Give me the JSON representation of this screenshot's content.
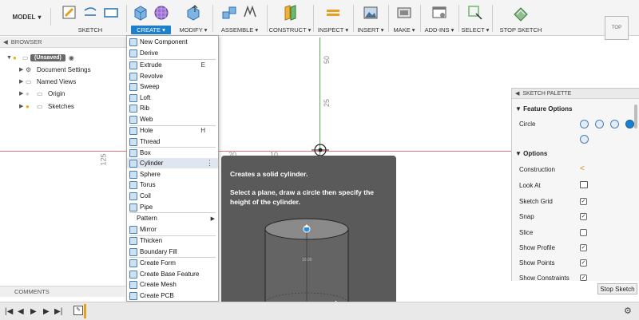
{
  "toolbar": {
    "model_label": "MODEL",
    "groups": [
      "SKETCH",
      "CREATE",
      "MODIFY",
      "ASSEMBLE",
      "CONSTRUCT",
      "INSPECT",
      "INSERT",
      "MAKE",
      "ADD-INS",
      "SELECT",
      "STOP SKETCH"
    ],
    "accent_color": "#1e7fcb"
  },
  "viewcube": {
    "label": "TOP"
  },
  "browser": {
    "title": "BROWSER",
    "items": [
      {
        "label": "(Unsaved)",
        "icon": "lightbulb-icon"
      },
      {
        "label": "Document Settings",
        "icon": "gear-icon"
      },
      {
        "label": "Named Views",
        "icon": "folder-icon"
      },
      {
        "label": "Origin",
        "icon": "folder-icon"
      },
      {
        "label": "Sketches",
        "icon": "folder-icon"
      }
    ]
  },
  "canvas": {
    "ruler_labels": [
      "50",
      "25",
      "125",
      "20",
      "10"
    ]
  },
  "create_menu": {
    "items": [
      {
        "label": "New Component",
        "shortcut": ""
      },
      {
        "label": "Derive",
        "shortcut": ""
      },
      {
        "label": "Extrude",
        "shortcut": "E"
      },
      {
        "label": "Revolve",
        "shortcut": ""
      },
      {
        "label": "Sweep",
        "shortcut": ""
      },
      {
        "label": "Loft",
        "shortcut": ""
      },
      {
        "label": "Rib",
        "shortcut": ""
      },
      {
        "label": "Web",
        "shortcut": ""
      },
      {
        "label": "Hole",
        "shortcut": "H"
      },
      {
        "label": "Thread",
        "shortcut": ""
      },
      {
        "label": "Box",
        "shortcut": ""
      },
      {
        "label": "Cylinder",
        "shortcut": ""
      },
      {
        "label": "Sphere",
        "shortcut": ""
      },
      {
        "label": "Torus",
        "shortcut": ""
      },
      {
        "label": "Coil",
        "shortcut": ""
      },
      {
        "label": "Pipe",
        "shortcut": ""
      },
      {
        "label": "Pattern",
        "shortcut": ""
      },
      {
        "label": "Mirror",
        "shortcut": ""
      },
      {
        "label": "Thicken",
        "shortcut": ""
      },
      {
        "label": "Boundary Fill",
        "shortcut": ""
      },
      {
        "label": "Create Form",
        "shortcut": ""
      },
      {
        "label": "Create Base Feature",
        "shortcut": ""
      },
      {
        "label": "Create Mesh",
        "shortcut": ""
      },
      {
        "label": "Create PCB",
        "shortcut": ""
      }
    ],
    "highlighted": "Cylinder"
  },
  "tooltip": {
    "title": "Creates a solid cylinder.",
    "body": "Select a plane, draw a circle then specify the height of the cylinder.",
    "dim_label": "10.00"
  },
  "sketch_palette": {
    "title": "SKETCH PALETTE",
    "feature_options_label": "Feature Options",
    "circle_label": "Circle",
    "options_label": "Options",
    "rows": [
      {
        "label": "Construction",
        "control": "icon"
      },
      {
        "label": "Look At",
        "control": "icon"
      },
      {
        "label": "Sketch Grid",
        "checked": true
      },
      {
        "label": "Snap",
        "checked": true
      },
      {
        "label": "Slice",
        "checked": false
      },
      {
        "label": "Show Profile",
        "checked": true
      },
      {
        "label": "Show Points",
        "checked": true
      },
      {
        "label": "Show Constraints",
        "checked": true
      }
    ],
    "stop_button": "Stop Sketch"
  },
  "comments": {
    "label": "COMMENTS"
  }
}
